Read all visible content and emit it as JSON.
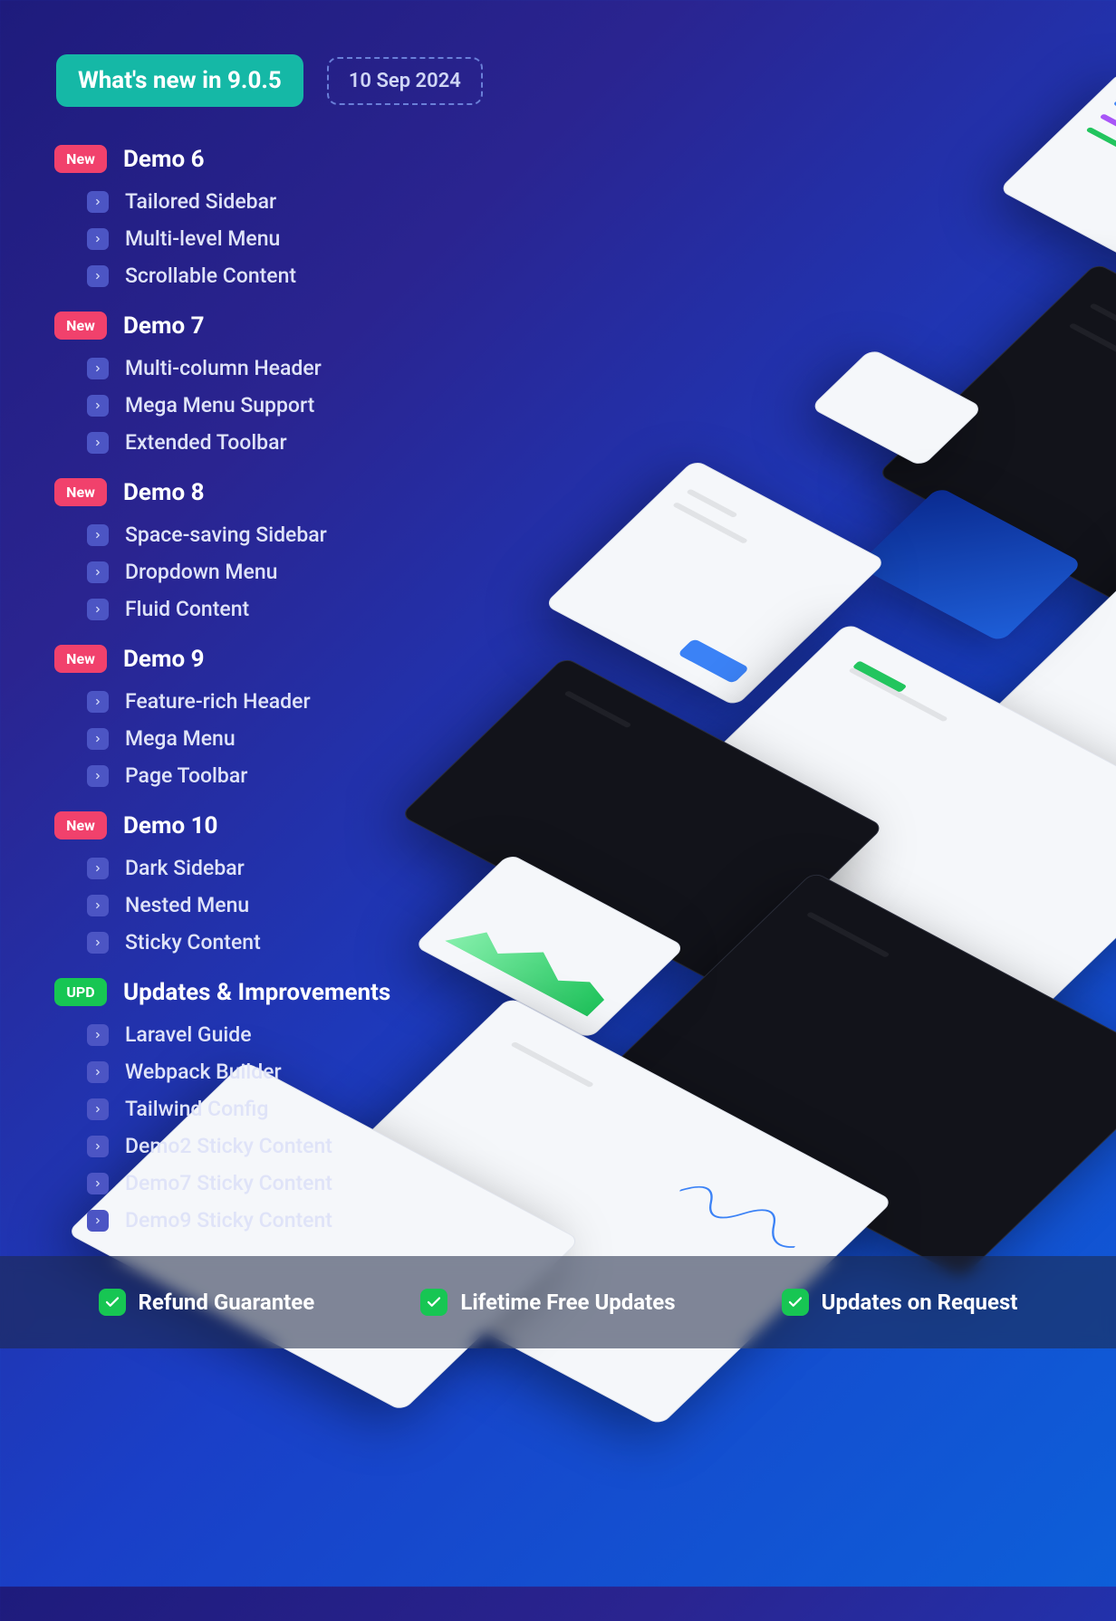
{
  "header": {
    "version_label": "What's new in 9.0.5",
    "date_label": "10 Sep 2024"
  },
  "tags": {
    "new": "New",
    "upd": "UPD"
  },
  "sections": [
    {
      "tag": "new",
      "title": "Demo 6",
      "items": [
        "Tailored Sidebar",
        "Multi-level Menu",
        "Scrollable Content"
      ]
    },
    {
      "tag": "new",
      "title": "Demo 7",
      "items": [
        "Multi-column Header",
        "Mega Menu Support",
        "Extended Toolbar"
      ]
    },
    {
      "tag": "new",
      "title": "Demo 8",
      "items": [
        "Space-saving Sidebar",
        "Dropdown Menu",
        "Fluid Content"
      ]
    },
    {
      "tag": "new",
      "title": "Demo 9",
      "items": [
        "Feature-rich Header",
        "Mega Menu",
        "Page Toolbar"
      ]
    },
    {
      "tag": "new",
      "title": "Demo 10",
      "items": [
        "Dark Sidebar",
        "Nested Menu",
        "Sticky Content"
      ]
    },
    {
      "tag": "upd",
      "title": "Updates & Improvements",
      "items": [
        "Laravel Guide",
        "Webpack Builder",
        "Tailwind Config",
        "Demo2 Sticky Content",
        "Demo7 Sticky Content",
        "Demo9 Sticky Content"
      ]
    }
  ],
  "footer": [
    "Refund Guarantee",
    "Lifetime Free Updates",
    "Updates on Request"
  ]
}
